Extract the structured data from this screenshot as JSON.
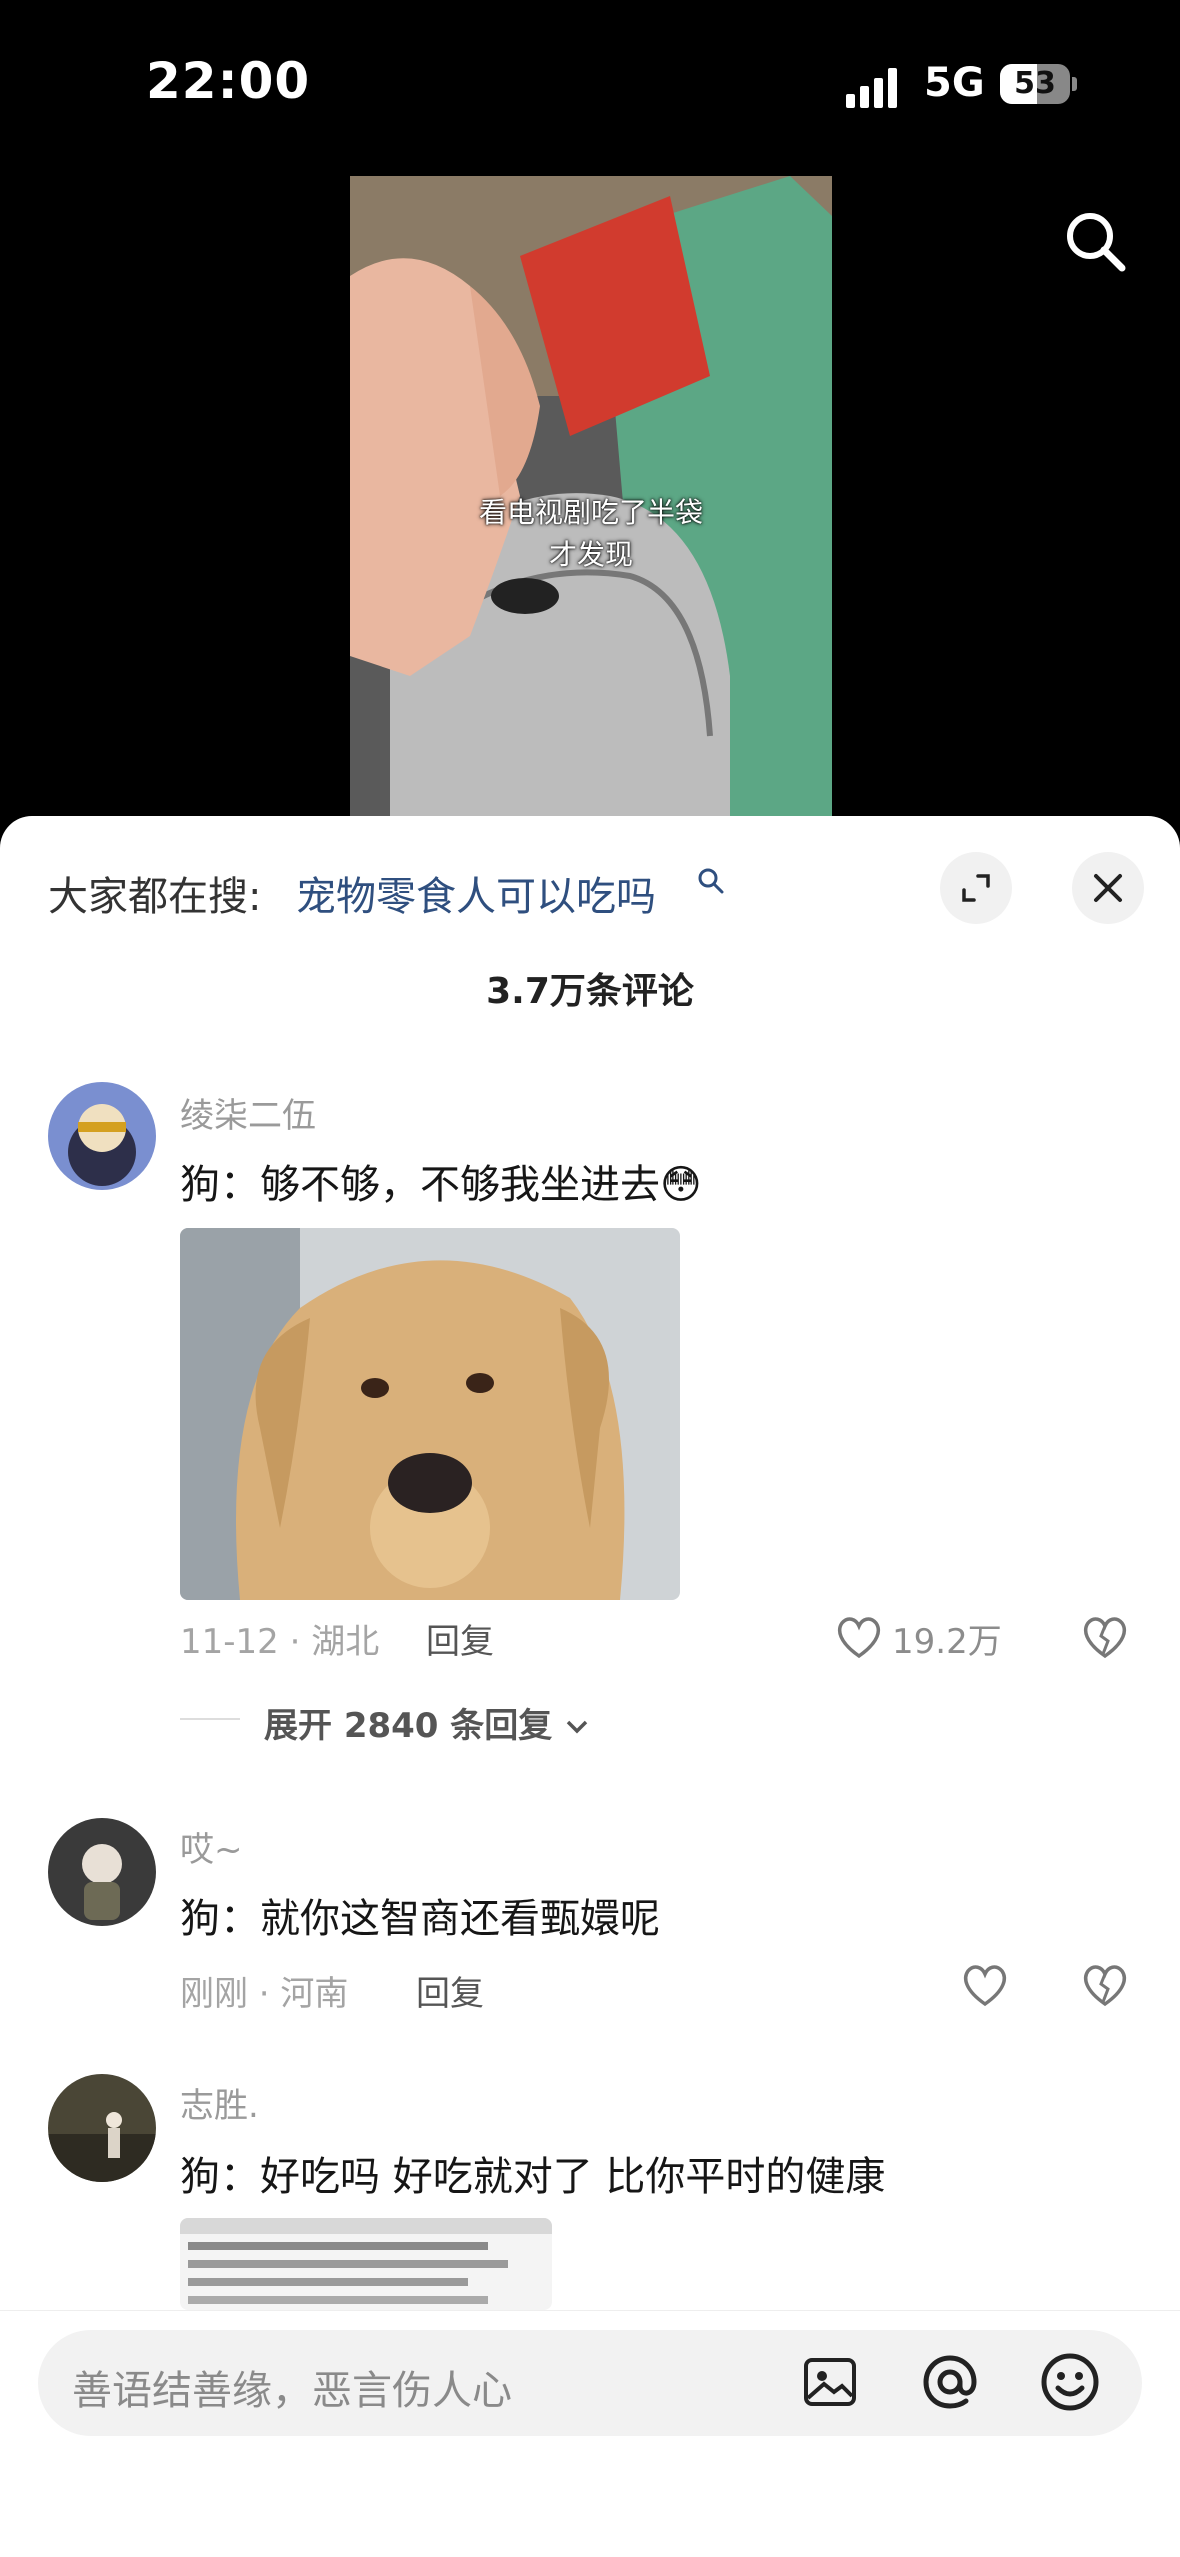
{
  "status": {
    "time": "22:00",
    "network": "5G",
    "battery": "53",
    "battery_level": 0.53
  },
  "video": {
    "caption_line1": "看电视剧吃了半袋",
    "caption_line2": "才发现"
  },
  "hot_search": {
    "prefix": "大家都在搜:",
    "term": "宠物零食人可以吃吗"
  },
  "comments_header": {
    "count": "3.7万条评论"
  },
  "comments": [
    {
      "name": "绫柒二伍",
      "text": "狗：够不够，不够我坐进去",
      "emoji": "😳",
      "meta": "11-12 · 湖北",
      "reply": "回复",
      "likes": "19.2万",
      "expand": "展开 2840 条回复"
    },
    {
      "name": "哎~",
      "text": "狗：就你这智商还看甄嬛呢",
      "meta": "刚刚 · 河南",
      "reply": "回复"
    },
    {
      "name": "志胜.",
      "text": "狗：好吃吗 好吃就对了 比你平时的健康"
    }
  ],
  "input": {
    "placeholder": "善语结善缘，恶言伤人心"
  },
  "icons": [
    "search-icon",
    "expand-icon",
    "close-icon",
    "heart-icon",
    "broken-heart-icon",
    "chevron-down-icon",
    "image-icon",
    "at-icon",
    "smiley-icon"
  ]
}
